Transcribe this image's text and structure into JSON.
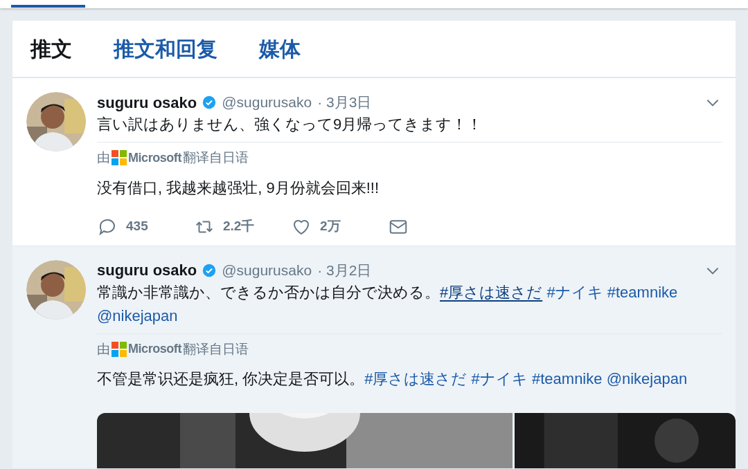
{
  "tabs": [
    {
      "label": "推文",
      "selected": true
    },
    {
      "label": "推文和回复",
      "selected": false
    },
    {
      "label": "媒体",
      "selected": false
    }
  ],
  "tweets": [
    {
      "highlighted": false,
      "name": "suguru osako",
      "verified": true,
      "handle": "@sugurusako",
      "date": "· 3月3日",
      "text": [
        {
          "kind": "text",
          "text": "言い訳はありません、強くなって9月帰ってきます！！"
        }
      ],
      "translation_label": {
        "prefix": "由",
        "brand": "Microsoft",
        "suffix": "翻译自日语"
      },
      "translation": [
        {
          "kind": "text",
          "text": "没有借口, 我越来越强壮, 9月份就会回来!!!"
        }
      ],
      "actions": [
        {
          "kind": "reply",
          "count": "435"
        },
        {
          "kind": "retweet",
          "count": "2.2千"
        },
        {
          "kind": "like",
          "count": "2万"
        },
        {
          "kind": "message"
        }
      ]
    },
    {
      "highlighted": true,
      "name": "suguru osako",
      "verified": true,
      "handle": "@sugurusako",
      "date": "· 3月2日",
      "text": [
        {
          "kind": "text",
          "text": "常識か非常識か、できるか否かは自分で決める。"
        },
        {
          "kind": "hashtag",
          "text": "#厚さは速さだ",
          "underlined": true
        },
        {
          "kind": "hashtag",
          "text": "#ナイキ",
          "underlined": false
        },
        {
          "kind": "hashtag",
          "text": "#teamnike",
          "underlined": false
        },
        {
          "kind": "mention",
          "text": "@nikejapan",
          "underlined": false
        }
      ],
      "translation_label": {
        "prefix": "由",
        "brand": "Microsoft",
        "suffix": "翻译自日语"
      },
      "translation": [
        {
          "kind": "text",
          "text": "不管是常识还是疯狂, 你决定是否可以。"
        },
        {
          "kind": "hashtag",
          "text": "#厚さは速さだ",
          "underlined": false
        },
        {
          "kind": "hashtag",
          "text": "#ナイキ",
          "underlined": false
        },
        {
          "kind": "hashtag",
          "text": "#teamnike",
          "underlined": false
        },
        {
          "kind": "mention",
          "text": "@nikejapan",
          "underlined": false
        }
      ]
    }
  ]
}
